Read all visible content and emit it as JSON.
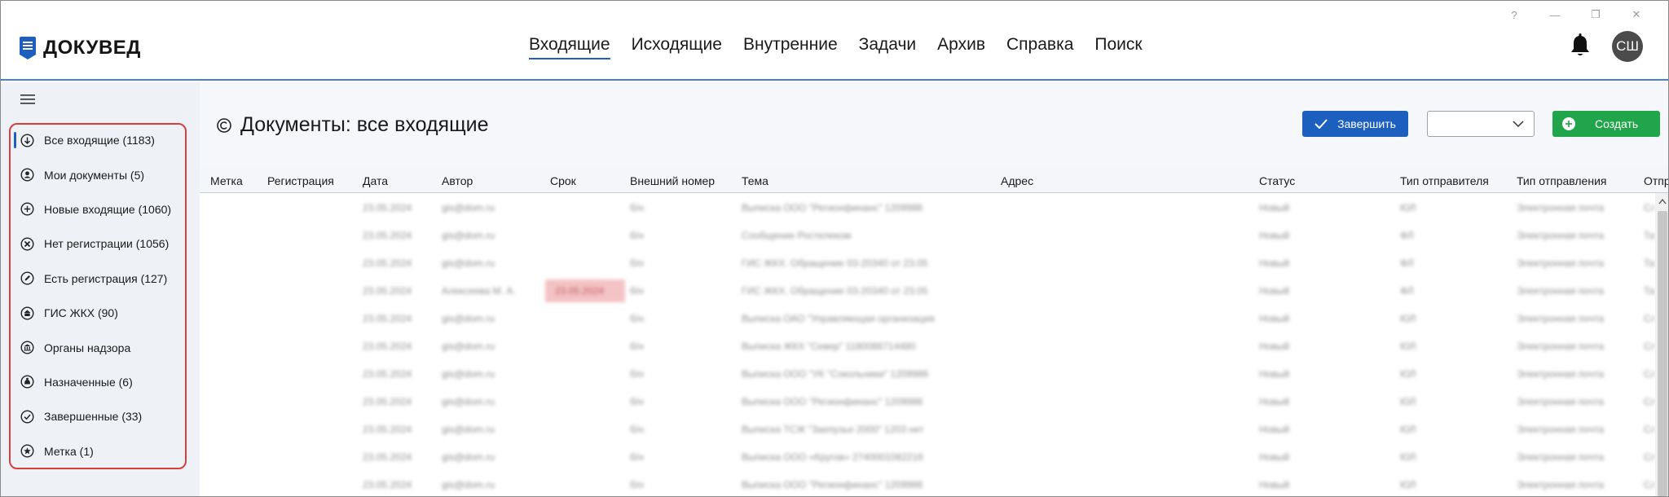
{
  "app": {
    "name": "ДОКУВЕД",
    "avatar_initials": "СШ",
    "accent_color": "#1c5fbf",
    "create_color": "#21a54a",
    "highlight_color": "#d6413f"
  },
  "window_controls": [
    "?",
    "—",
    "❐",
    "✕"
  ],
  "top_nav": [
    {
      "label": "Входящие",
      "active": true
    },
    {
      "label": "Исходящие"
    },
    {
      "label": "Внутренние"
    },
    {
      "label": "Задачи"
    },
    {
      "label": "Архив"
    },
    {
      "label": "Справка"
    },
    {
      "label": "Поиск"
    }
  ],
  "sidebar": {
    "items": [
      {
        "label": "Все входящие (1183)",
        "icon": "arrow-down-circle-icon",
        "active": true
      },
      {
        "label": "Мои документы (5)",
        "icon": "user-circle-icon"
      },
      {
        "label": "Новые входящие (1060)",
        "icon": "plus-circle-icon"
      },
      {
        "label": "Нет регистрации (1056)",
        "icon": "x-circle-icon"
      },
      {
        "label": "Есть регистрация (127)",
        "icon": "pen-circle-icon"
      },
      {
        "label": "ГИС ЖКХ (90)",
        "icon": "building-circle-icon"
      },
      {
        "label": "Органы надзора",
        "icon": "institution-circle-icon"
      },
      {
        "label": "Назначенные (6)",
        "icon": "assigned-circle-icon"
      },
      {
        "label": "Завершенные (33)",
        "icon": "check-circle-icon"
      },
      {
        "label": "Метка (1)",
        "icon": "star-circle-icon"
      }
    ]
  },
  "page": {
    "title": "Документы: все входящие",
    "finish_label": "Завершить",
    "create_label": "Создать",
    "select_value": ""
  },
  "table": {
    "columns": [
      "Метка",
      "Регистрация",
      "Дата",
      "Автор",
      "Срок",
      "Внешний номер",
      "Тема",
      "Адрес",
      "Статус",
      "Тип отправителя",
      "Тип отправления",
      "Отпр"
    ],
    "rows": [
      {
        "date": "23.05.2024",
        "author": "gis@dom.ru",
        "deadline": "",
        "ext": "б/н",
        "subject": "Выписка ООО \"Регионфинанс\" 1209986",
        "status": "Новый",
        "sender_type": "ЮЛ",
        "send_type": "Электронная почта",
        "extra": "Сл"
      },
      {
        "date": "23.05.2024",
        "author": "gis@dom.ru",
        "deadline": "",
        "ext": "б/н",
        "subject": "Сообщение Ростелеком",
        "status": "Новый",
        "sender_type": "ФЛ",
        "send_type": "Электронная почта",
        "extra": "Та"
      },
      {
        "date": "23.05.2024",
        "author": "gis@dom.ru",
        "deadline": "",
        "ext": "б/н",
        "subject": "ГИС ЖКХ. Обращение 03-20340 от 23.05",
        "status": "Новый",
        "sender_type": "ФЛ",
        "send_type": "Электронная почта",
        "extra": "Та"
      },
      {
        "date": "23.05.2024",
        "author": "Алексеева М. А.",
        "deadline": "23.05.2024",
        "ext": "б/н",
        "subject": "ГИС ЖКХ. Обращение 03-20340 от 23.05",
        "status": "Новый",
        "sender_type": "ФЛ",
        "send_type": "Электронная почта",
        "extra": "Та"
      },
      {
        "date": "23.05.2024",
        "author": "gis@dom.ru",
        "deadline": "",
        "ext": "б/н",
        "subject": "Выписка ОАО \"Управляющая организация",
        "status": "Новый",
        "sender_type": "ЮЛ",
        "send_type": "Электронная почта",
        "extra": "Сл"
      },
      {
        "date": "23.05.2024",
        "author": "gis@dom.ru",
        "deadline": "",
        "ext": "б/н",
        "subject": "Выписка ЖКХ \"Север\" 1180086714480",
        "status": "Новый",
        "sender_type": "ЮЛ",
        "send_type": "Электронная почта",
        "extra": "Сл"
      },
      {
        "date": "23.05.2024",
        "author": "gis@dom.ru",
        "deadline": "",
        "ext": "б/н",
        "subject": "Выписка ООО \"УК \"Сокольники\" 1209986",
        "status": "Новый",
        "sender_type": "ЮЛ",
        "send_type": "Электронная почта",
        "extra": "Сл"
      },
      {
        "date": "23.05.2024",
        "author": "gis@dom.ru",
        "deadline": "",
        "ext": "б/н",
        "subject": "Выписка ООО \"Регионфинанс\" 1209986",
        "status": "Новый",
        "sender_type": "ЮЛ",
        "send_type": "Электронная почта",
        "extra": "Сл"
      },
      {
        "date": "23.05.2024",
        "author": "gis@dom.ru",
        "deadline": "",
        "ext": "б/н",
        "subject": "Выписка ТСЖ \"Заепузье 2000\" 1203 нет",
        "status": "Новый",
        "sender_type": "ЮЛ",
        "send_type": "Электронная почта",
        "extra": "Сл"
      },
      {
        "date": "23.05.2024",
        "author": "gis@dom.ru",
        "deadline": "",
        "ext": "б/н",
        "subject": "Выписка ООО «Кругов» 2740001082216",
        "status": "Новый",
        "sender_type": "ЮЛ",
        "send_type": "Электронная почта",
        "extra": "Сл"
      },
      {
        "date": "23.05.2024",
        "author": "gis@dom.ru",
        "deadline": "",
        "ext": "б/н",
        "subject": "Выписка ООО \"Регионфинанс\" 1209986",
        "status": "Новый",
        "sender_type": "ЮЛ",
        "send_type": "Электронная почта",
        "extra": "Сл"
      }
    ]
  }
}
